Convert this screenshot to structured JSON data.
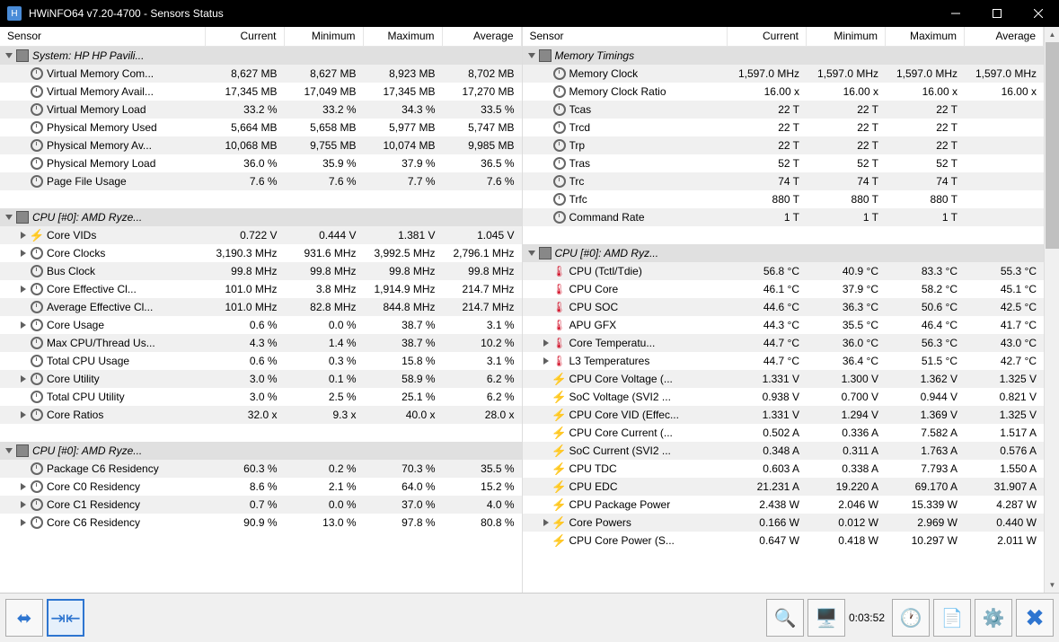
{
  "window": {
    "title": "HWiNFO64 v7.20-4700 - Sensors Status"
  },
  "headers": {
    "sensor": "Sensor",
    "current": "Current",
    "minimum": "Minimum",
    "maximum": "Maximum",
    "average": "Average"
  },
  "left_rows": [
    {
      "type": "group",
      "indent": 0,
      "exp": "down",
      "icon": "chip",
      "label": "System: HP HP Pavili...",
      "italic": true
    },
    {
      "type": "data",
      "indent": 1,
      "icon": "clock",
      "label": "Virtual Memory Com...",
      "cur": "8,627 MB",
      "min": "8,627 MB",
      "max": "8,923 MB",
      "avg": "8,702 MB"
    },
    {
      "type": "data",
      "indent": 1,
      "icon": "clock",
      "label": "Virtual Memory Avail...",
      "cur": "17,345 MB",
      "min": "17,049 MB",
      "max": "17,345 MB",
      "avg": "17,270 MB"
    },
    {
      "type": "data",
      "indent": 1,
      "icon": "clock",
      "label": "Virtual Memory Load",
      "cur": "33.2 %",
      "min": "33.2 %",
      "max": "34.3 %",
      "avg": "33.5 %"
    },
    {
      "type": "data",
      "indent": 1,
      "icon": "clock",
      "label": "Physical Memory Used",
      "cur": "5,664 MB",
      "min": "5,658 MB",
      "max": "5,977 MB",
      "avg": "5,747 MB"
    },
    {
      "type": "data",
      "indent": 1,
      "icon": "clock",
      "label": "Physical Memory Av...",
      "cur": "10,068 MB",
      "min": "9,755 MB",
      "max": "10,074 MB",
      "avg": "9,985 MB"
    },
    {
      "type": "data",
      "indent": 1,
      "icon": "clock",
      "label": "Physical Memory Load",
      "cur": "36.0 %",
      "min": "35.9 %",
      "max": "37.9 %",
      "avg": "36.5 %"
    },
    {
      "type": "data",
      "indent": 1,
      "icon": "clock",
      "label": "Page File Usage",
      "cur": "7.6 %",
      "min": "7.6 %",
      "max": "7.7 %",
      "avg": "7.6 %"
    },
    {
      "type": "blank"
    },
    {
      "type": "group",
      "indent": 0,
      "exp": "down",
      "icon": "chip",
      "label": "CPU [#0]: AMD Ryze...",
      "italic": true
    },
    {
      "type": "data",
      "indent": 1,
      "exp": "right",
      "icon": "bolt",
      "label": "Core VIDs",
      "cur": "0.722 V",
      "min": "0.444 V",
      "max": "1.381 V",
      "avg": "1.045 V"
    },
    {
      "type": "data",
      "indent": 1,
      "exp": "right",
      "icon": "clock",
      "label": "Core Clocks",
      "cur": "3,190.3 MHz",
      "min": "931.6 MHz",
      "max": "3,992.5 MHz",
      "avg": "2,796.1 MHz"
    },
    {
      "type": "data",
      "indent": 1,
      "icon": "clock",
      "label": "Bus Clock",
      "cur": "99.8 MHz",
      "min": "99.8 MHz",
      "max": "99.8 MHz",
      "avg": "99.8 MHz"
    },
    {
      "type": "data",
      "indent": 1,
      "exp": "right",
      "icon": "clock",
      "label": "Core Effective Cl...",
      "cur": "101.0 MHz",
      "min": "3.8 MHz",
      "max": "1,914.9 MHz",
      "avg": "214.7 MHz"
    },
    {
      "type": "data",
      "indent": 1,
      "icon": "clock",
      "label": "Average Effective Cl...",
      "cur": "101.0 MHz",
      "min": "82.8 MHz",
      "max": "844.8 MHz",
      "avg": "214.7 MHz"
    },
    {
      "type": "data",
      "indent": 1,
      "exp": "right",
      "icon": "clock",
      "label": "Core Usage",
      "cur": "0.6 %",
      "min": "0.0 %",
      "max": "38.7 %",
      "avg": "3.1 %"
    },
    {
      "type": "data",
      "indent": 1,
      "icon": "clock",
      "label": "Max CPU/Thread Us...",
      "cur": "4.3 %",
      "min": "1.4 %",
      "max": "38.7 %",
      "avg": "10.2 %"
    },
    {
      "type": "data",
      "indent": 1,
      "icon": "clock",
      "label": "Total CPU Usage",
      "cur": "0.6 %",
      "min": "0.3 %",
      "max": "15.8 %",
      "avg": "3.1 %"
    },
    {
      "type": "data",
      "indent": 1,
      "exp": "right",
      "icon": "clock",
      "label": "Core Utility",
      "cur": "3.0 %",
      "min": "0.1 %",
      "max": "58.9 %",
      "avg": "6.2 %"
    },
    {
      "type": "data",
      "indent": 1,
      "icon": "clock",
      "label": "Total CPU Utility",
      "cur": "3.0 %",
      "min": "2.5 %",
      "max": "25.1 %",
      "avg": "6.2 %"
    },
    {
      "type": "data",
      "indent": 1,
      "exp": "right",
      "icon": "clock",
      "label": "Core Ratios",
      "cur": "32.0 x",
      "min": "9.3 x",
      "max": "40.0 x",
      "avg": "28.0 x"
    },
    {
      "type": "blank"
    },
    {
      "type": "group",
      "indent": 0,
      "exp": "down",
      "icon": "chip",
      "label": "CPU [#0]: AMD Ryze...",
      "italic": true
    },
    {
      "type": "data",
      "indent": 1,
      "icon": "clock",
      "label": "Package C6 Residency",
      "cur": "60.3 %",
      "min": "0.2 %",
      "max": "70.3 %",
      "avg": "35.5 %"
    },
    {
      "type": "data",
      "indent": 1,
      "exp": "right",
      "icon": "clock",
      "label": "Core C0 Residency",
      "cur": "8.6 %",
      "min": "2.1 %",
      "max": "64.0 %",
      "avg": "15.2 %"
    },
    {
      "type": "data",
      "indent": 1,
      "exp": "right",
      "icon": "clock",
      "label": "Core C1 Residency",
      "cur": "0.7 %",
      "min": "0.0 %",
      "max": "37.0 %",
      "avg": "4.0 %"
    },
    {
      "type": "data",
      "indent": 1,
      "exp": "right",
      "icon": "clock",
      "label": "Core C6 Residency",
      "cur": "90.9 %",
      "min": "13.0 %",
      "max": "97.8 %",
      "avg": "80.8 %"
    }
  ],
  "right_rows": [
    {
      "type": "group",
      "indent": 0,
      "exp": "down",
      "icon": "chip",
      "label": "Memory Timings",
      "italic": true
    },
    {
      "type": "data",
      "indent": 1,
      "icon": "clock",
      "label": "Memory Clock",
      "cur": "1,597.0 MHz",
      "min": "1,597.0 MHz",
      "max": "1,597.0 MHz",
      "avg": "1,597.0 MHz"
    },
    {
      "type": "data",
      "indent": 1,
      "icon": "clock",
      "label": "Memory Clock Ratio",
      "cur": "16.00 x",
      "min": "16.00 x",
      "max": "16.00 x",
      "avg": "16.00 x"
    },
    {
      "type": "data",
      "indent": 1,
      "icon": "clock",
      "label": "Tcas",
      "cur": "22 T",
      "min": "22 T",
      "max": "22 T",
      "avg": ""
    },
    {
      "type": "data",
      "indent": 1,
      "icon": "clock",
      "label": "Trcd",
      "cur": "22 T",
      "min": "22 T",
      "max": "22 T",
      "avg": ""
    },
    {
      "type": "data",
      "indent": 1,
      "icon": "clock",
      "label": "Trp",
      "cur": "22 T",
      "min": "22 T",
      "max": "22 T",
      "avg": ""
    },
    {
      "type": "data",
      "indent": 1,
      "icon": "clock",
      "label": "Tras",
      "cur": "52 T",
      "min": "52 T",
      "max": "52 T",
      "avg": ""
    },
    {
      "type": "data",
      "indent": 1,
      "icon": "clock",
      "label": "Trc",
      "cur": "74 T",
      "min": "74 T",
      "max": "74 T",
      "avg": ""
    },
    {
      "type": "data",
      "indent": 1,
      "icon": "clock",
      "label": "Trfc",
      "cur": "880 T",
      "min": "880 T",
      "max": "880 T",
      "avg": ""
    },
    {
      "type": "data",
      "indent": 1,
      "icon": "clock",
      "label": "Command Rate",
      "cur": "1 T",
      "min": "1 T",
      "max": "1 T",
      "avg": ""
    },
    {
      "type": "blank"
    },
    {
      "type": "group",
      "indent": 0,
      "exp": "down",
      "icon": "chip",
      "label": "CPU [#0]: AMD Ryz...",
      "italic": true
    },
    {
      "type": "data",
      "indent": 1,
      "icon": "therm",
      "label": "CPU (Tctl/Tdie)",
      "cur": "56.8 °C",
      "min": "40.9 °C",
      "max": "83.3 °C",
      "avg": "55.3 °C"
    },
    {
      "type": "data",
      "indent": 1,
      "icon": "therm",
      "label": "CPU Core",
      "cur": "46.1 °C",
      "min": "37.9 °C",
      "max": "58.2 °C",
      "avg": "45.1 °C"
    },
    {
      "type": "data",
      "indent": 1,
      "icon": "therm",
      "label": "CPU SOC",
      "cur": "44.6 °C",
      "min": "36.3 °C",
      "max": "50.6 °C",
      "avg": "42.5 °C"
    },
    {
      "type": "data",
      "indent": 1,
      "icon": "therm",
      "label": "APU GFX",
      "cur": "44.3 °C",
      "min": "35.5 °C",
      "max": "46.4 °C",
      "avg": "41.7 °C"
    },
    {
      "type": "data",
      "indent": 1,
      "exp": "right",
      "icon": "therm",
      "label": "Core Temperatu...",
      "cur": "44.7 °C",
      "min": "36.0 °C",
      "max": "56.3 °C",
      "avg": "43.0 °C"
    },
    {
      "type": "data",
      "indent": 1,
      "exp": "right",
      "icon": "therm",
      "label": "L3 Temperatures",
      "cur": "44.7 °C",
      "min": "36.4 °C",
      "max": "51.5 °C",
      "avg": "42.7 °C"
    },
    {
      "type": "data",
      "indent": 1,
      "icon": "bolt",
      "label": "CPU Core Voltage (...",
      "cur": "1.331 V",
      "min": "1.300 V",
      "max": "1.362 V",
      "avg": "1.325 V"
    },
    {
      "type": "data",
      "indent": 1,
      "icon": "bolt",
      "label": "SoC Voltage (SVI2 ...",
      "cur": "0.938 V",
      "min": "0.700 V",
      "max": "0.944 V",
      "avg": "0.821 V"
    },
    {
      "type": "data",
      "indent": 1,
      "icon": "bolt",
      "label": "CPU Core VID (Effec...",
      "cur": "1.331 V",
      "min": "1.294 V",
      "max": "1.369 V",
      "avg": "1.325 V"
    },
    {
      "type": "data",
      "indent": 1,
      "icon": "bolt",
      "label": "CPU Core Current (...",
      "cur": "0.502 A",
      "min": "0.336 A",
      "max": "7.582 A",
      "avg": "1.517 A"
    },
    {
      "type": "data",
      "indent": 1,
      "icon": "bolt",
      "label": "SoC Current (SVI2 ...",
      "cur": "0.348 A",
      "min": "0.311 A",
      "max": "1.763 A",
      "avg": "0.576 A"
    },
    {
      "type": "data",
      "indent": 1,
      "icon": "bolt",
      "label": "CPU TDC",
      "cur": "0.603 A",
      "min": "0.338 A",
      "max": "7.793 A",
      "avg": "1.550 A"
    },
    {
      "type": "data",
      "indent": 1,
      "icon": "bolt",
      "label": "CPU EDC",
      "cur": "21.231 A",
      "min": "19.220 A",
      "max": "69.170 A",
      "avg": "31.907 A"
    },
    {
      "type": "data",
      "indent": 1,
      "icon": "bolt",
      "label": "CPU Package Power",
      "cur": "2.438 W",
      "min": "2.046 W",
      "max": "15.339 W",
      "avg": "4.287 W"
    },
    {
      "type": "data",
      "indent": 1,
      "exp": "right",
      "icon": "bolt",
      "label": "Core Powers",
      "cur": "0.166 W",
      "min": "0.012 W",
      "max": "2.969 W",
      "avg": "0.440 W"
    },
    {
      "type": "data",
      "indent": 1,
      "icon": "bolt",
      "label": "CPU Core Power (S...",
      "cur": "0.647 W",
      "min": "0.418 W",
      "max": "10.297 W",
      "avg": "2.011 W"
    }
  ],
  "toolbar": {
    "time": "0:03:52"
  }
}
